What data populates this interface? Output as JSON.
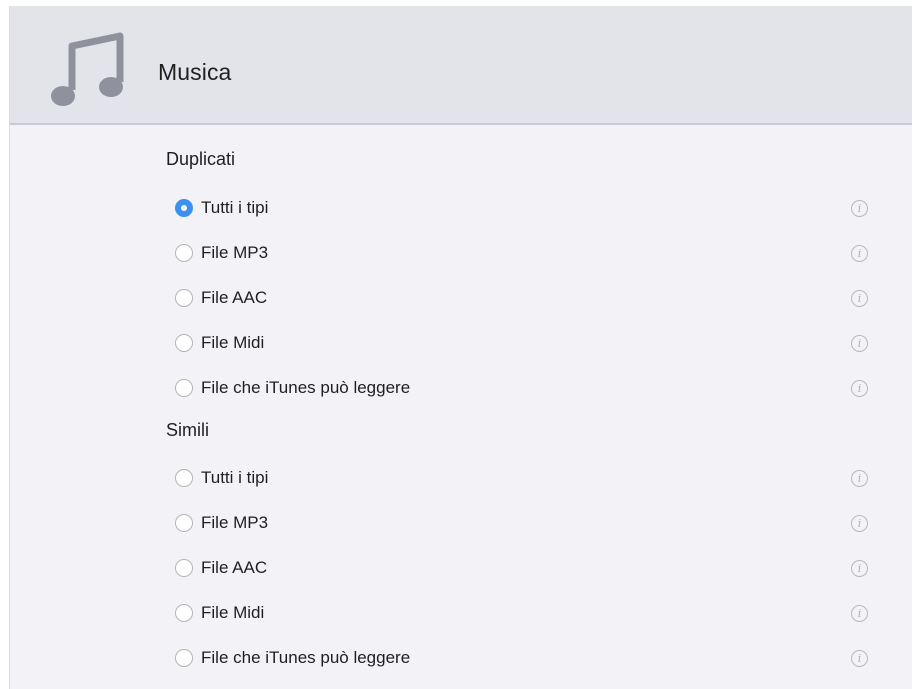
{
  "header": {
    "icon": "music-note-icon",
    "title": "Musica"
  },
  "colors": {
    "header_bg": "#e2e4ea",
    "content_bg": "#f3f2f7",
    "radio_selected": "#3c91f0",
    "info_icon": "#b0b0b5"
  },
  "info_glyph": "i",
  "sections": [
    {
      "title": "Duplicati",
      "options": [
        {
          "label": "Tutti i tipi",
          "selected": true
        },
        {
          "label": "File MP3",
          "selected": false
        },
        {
          "label": "File AAC",
          "selected": false
        },
        {
          "label": "File Midi",
          "selected": false
        },
        {
          "label": "File che iTunes può leggere",
          "selected": false
        }
      ]
    },
    {
      "title": "Simili",
      "options": [
        {
          "label": "Tutti i tipi",
          "selected": false
        },
        {
          "label": "File MP3",
          "selected": false
        },
        {
          "label": "File AAC",
          "selected": false
        },
        {
          "label": "File Midi",
          "selected": false
        },
        {
          "label": "File che iTunes può leggere",
          "selected": false
        }
      ]
    }
  ]
}
